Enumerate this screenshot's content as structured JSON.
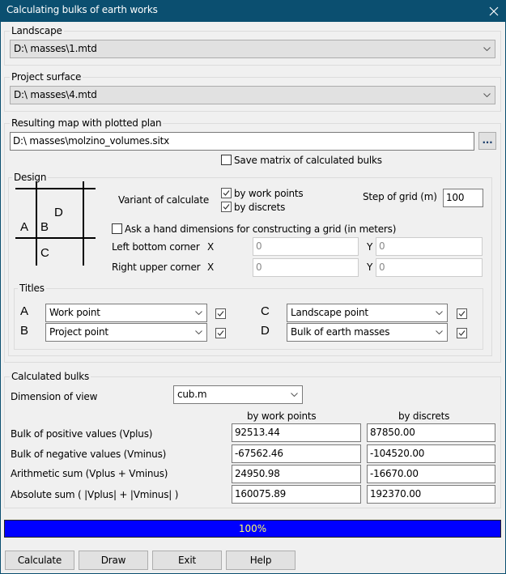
{
  "window": {
    "title": "Calculating bulks of earth works",
    "close_icon": "close-icon"
  },
  "landscape": {
    "label": "Landscape",
    "value": "D:\\ masses\\1.mtd"
  },
  "project_surface": {
    "label": "Project surface",
    "value": "D:\\ masses\\4.mtd"
  },
  "result_map": {
    "label": "Resulting map with plotted plan",
    "value": "D:\\ masses\\molzino_volumes.sitx",
    "browse_label": "...",
    "save_matrix_label": "Save matrix of calculated bulks",
    "save_matrix_checked": false
  },
  "design": {
    "label": "Design",
    "diagram_letters": [
      "A",
      "B",
      "C",
      "D"
    ],
    "variant_label": "Variant of calculate",
    "by_work_points_label": "by work points",
    "by_work_points_checked": true,
    "by_discrets_label": "by discrets",
    "by_discrets_checked": true,
    "step_label": "Step of grid (m)",
    "step_value": "100",
    "ask_hand_label": "Ask a hand dimensions for constructing a grid (in meters)",
    "ask_hand_checked": false,
    "left_bottom_label": "Left bottom corner",
    "right_upper_label": "Right upper corner",
    "x_label": "X",
    "y_label": "Y",
    "left_bottom_x": "0",
    "left_bottom_y": "0",
    "right_upper_x": "0",
    "right_upper_y": "0",
    "titles": {
      "label": "Titles",
      "items": [
        {
          "letter": "A",
          "value": "Work point",
          "checked": true
        },
        {
          "letter": "B",
          "value": "Project point",
          "checked": true
        },
        {
          "letter": "C",
          "value": "Landscape point",
          "checked": true
        },
        {
          "letter": "D",
          "value": "Bulk of earth masses",
          "checked": true
        }
      ]
    }
  },
  "calculated": {
    "label": "Calculated bulks",
    "dimension_label": "Dimension of view",
    "dimension_value": "cub.m",
    "col_work_points": "by work points",
    "col_discrets": "by discrets",
    "rows": [
      {
        "label": "Bulk of positive values (Vplus)",
        "work_points": "92513.44",
        "discrets": "87850.00"
      },
      {
        "label": "Bulk of negative values (Vminus)",
        "work_points": "-67562.46",
        "discrets": "-104520.00"
      },
      {
        "label": "Arithmetic sum (Vplus + Vminus)",
        "work_points": "24950.98",
        "discrets": "-16670.00"
      },
      {
        "label": "Absolute sum ( |Vplus| + |Vminus| )",
        "work_points": "160075.89",
        "discrets": "192370.00"
      }
    ]
  },
  "progress": {
    "percent": 100,
    "text": "100%",
    "fill_color": "#0000ff",
    "text_color": "#ffff66"
  },
  "buttons": {
    "calculate": "Calculate",
    "draw": "Draw",
    "exit": "Exit",
    "help": "Help"
  },
  "colors": {
    "titlebar": "#0b4f70",
    "client": "#f0f0f0"
  }
}
